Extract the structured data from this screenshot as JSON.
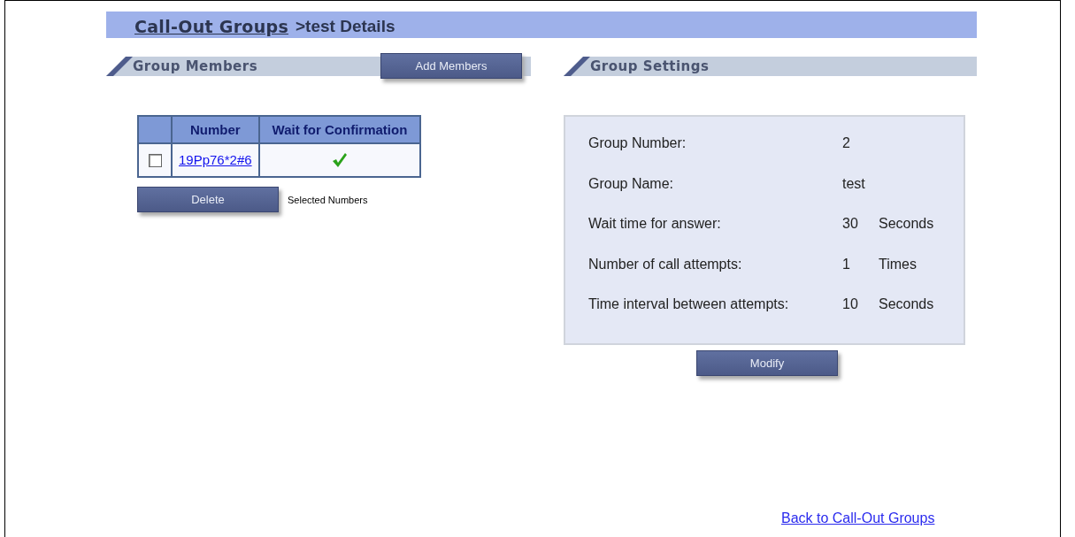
{
  "header": {
    "link": "Call-Out Groups",
    "title": ">test Details"
  },
  "members": {
    "heading": "Group Members",
    "add_button": "Add Members",
    "table": {
      "columns": [
        "Number",
        "Wait for Confirmation"
      ],
      "rows": [
        {
          "checked": false,
          "number": "19Pp76*2#6",
          "confirmed": true
        }
      ]
    },
    "delete_button": "Delete",
    "delete_note": "Selected Numbers"
  },
  "settings": {
    "heading": "Group Settings",
    "rows": [
      {
        "label": "Group Number:",
        "value": "2"
      },
      {
        "label": "Group Name:",
        "value": "test"
      },
      {
        "label": "Wait time for answer:",
        "value": "30",
        "unit": "Seconds"
      },
      {
        "label": "Number of call attempts:",
        "value": "1",
        "unit": "Times"
      },
      {
        "label": "Time interval between attempts:",
        "value": "10",
        "unit": "Seconds"
      }
    ],
    "modify_button": "Modify"
  },
  "back_link": "Back to Call-Out Groups"
}
